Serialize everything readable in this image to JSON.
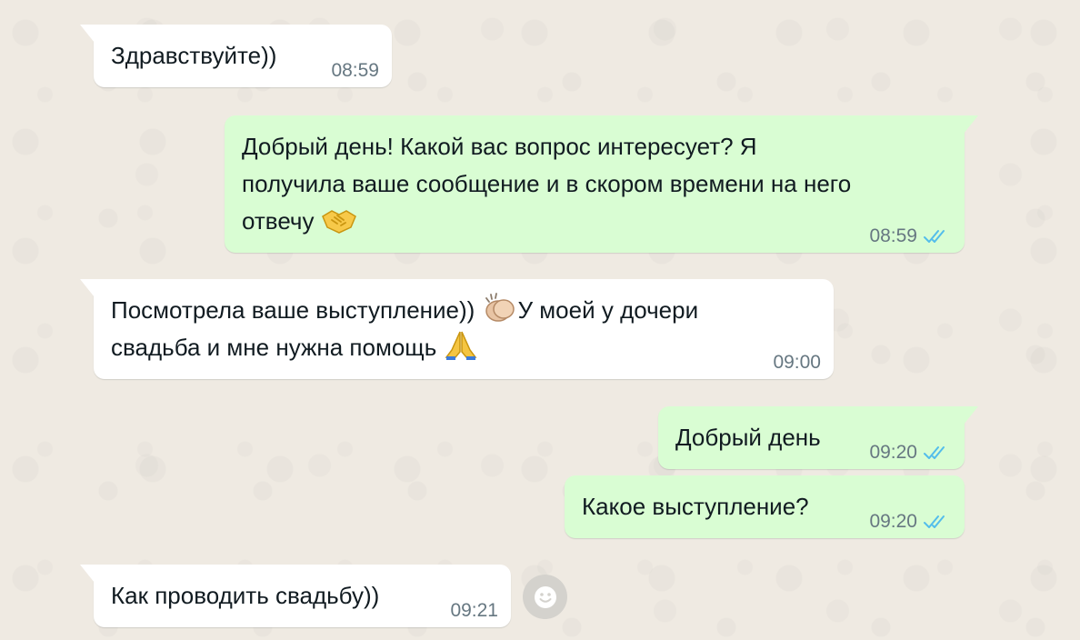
{
  "messages": [
    {
      "direction": "incoming",
      "text_lines": [
        "Здравствуйте))"
      ],
      "time": "08:59"
    },
    {
      "direction": "outgoing",
      "text_lines": [
        "Добрый день! Какой вас вопрос интересует? Я",
        "получила ваше сообщение и в скором времени на него",
        "отвечу"
      ],
      "time": "08:59",
      "read_receipt": "double-check-read"
    },
    {
      "direction": "incoming",
      "text_lines": [
        "Посмотрела ваше выступление))",
        "У моей у дочери",
        "свадьба и мне нужна помощь"
      ],
      "time": "09:00"
    },
    {
      "direction": "outgoing",
      "text_lines": [
        "Добрый день"
      ],
      "time": "09:20",
      "read_receipt": "double-check-read"
    },
    {
      "direction": "outgoing",
      "text_lines": [
        "Какое выступление?"
      ],
      "time": "09:20",
      "read_receipt": "double-check-read"
    },
    {
      "direction": "incoming",
      "text_lines": [
        "Как проводить свадьбу))"
      ],
      "time": "09:21"
    }
  ],
  "emojis": [
    "handshake-emoji",
    "clapping-hands-emoji",
    "folded-hands-emoji"
  ],
  "reaction_button": {
    "icon": "smiley-icon"
  },
  "colors": {
    "wallpaper": "#efeae2",
    "incoming_bubble": "#ffffff",
    "outgoing_bubble": "#d9fdd3",
    "text": "#111b21",
    "timestamp": "#667781",
    "read_receipt": "#53bdeb"
  }
}
